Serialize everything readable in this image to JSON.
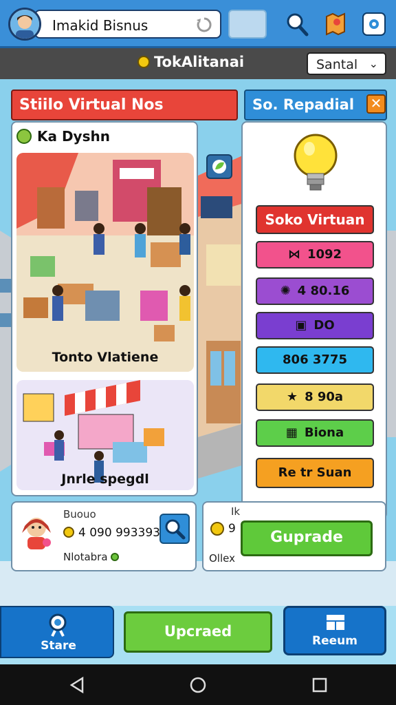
{
  "header": {
    "player_name": "Imakid Bisnus",
    "icons": [
      "avatar",
      "sync-icon",
      "search-icon",
      "map-icon",
      "settings-icon"
    ]
  },
  "subbar": {
    "title": "TokAlitanai",
    "dropdown_value": "Santal"
  },
  "left_panel": {
    "header": "Stiilo Virtual Nos",
    "card_title": "Ka Dyshn",
    "illustration1_label": "Tonto Vlatiene",
    "illustration2_label": "Jnrle spegdl"
  },
  "right_panel": {
    "header": "So. Repadial",
    "title_button": "Soko Virtuan",
    "rows": [
      {
        "text": "1092",
        "color": "#f2528c",
        "icon": "bow-icon"
      },
      {
        "text": "4 80.16",
        "color": "#9b4dd1",
        "icon": "sparkle-icon"
      },
      {
        "text": "DO",
        "color": "#7a3ed0",
        "icon": "gift-icon"
      },
      {
        "text": "806 3775",
        "color": "#2fb8ef",
        "icon": ""
      },
      {
        "text": "8 90a",
        "color": "#f2d86a",
        "icon": "star-icon"
      },
      {
        "text": "Biona",
        "color": "#5dce4a",
        "icon": "box-icon"
      },
      {
        "text": "Re tr Suan",
        "color": "#f5a021",
        "icon": ""
      }
    ],
    "upgrade_label": "Guprade"
  },
  "info_card_left": {
    "title": "Buouo",
    "coins": "4 090 993393",
    "subtitle": "Nlotabra"
  },
  "info_card_right": {
    "letter": "Ik",
    "coins": "9",
    "subtitle": "Ollex"
  },
  "bottom_nav": {
    "store_label": "Stare",
    "upgrade_label": "Upcraed",
    "return_label": "Reeum"
  }
}
